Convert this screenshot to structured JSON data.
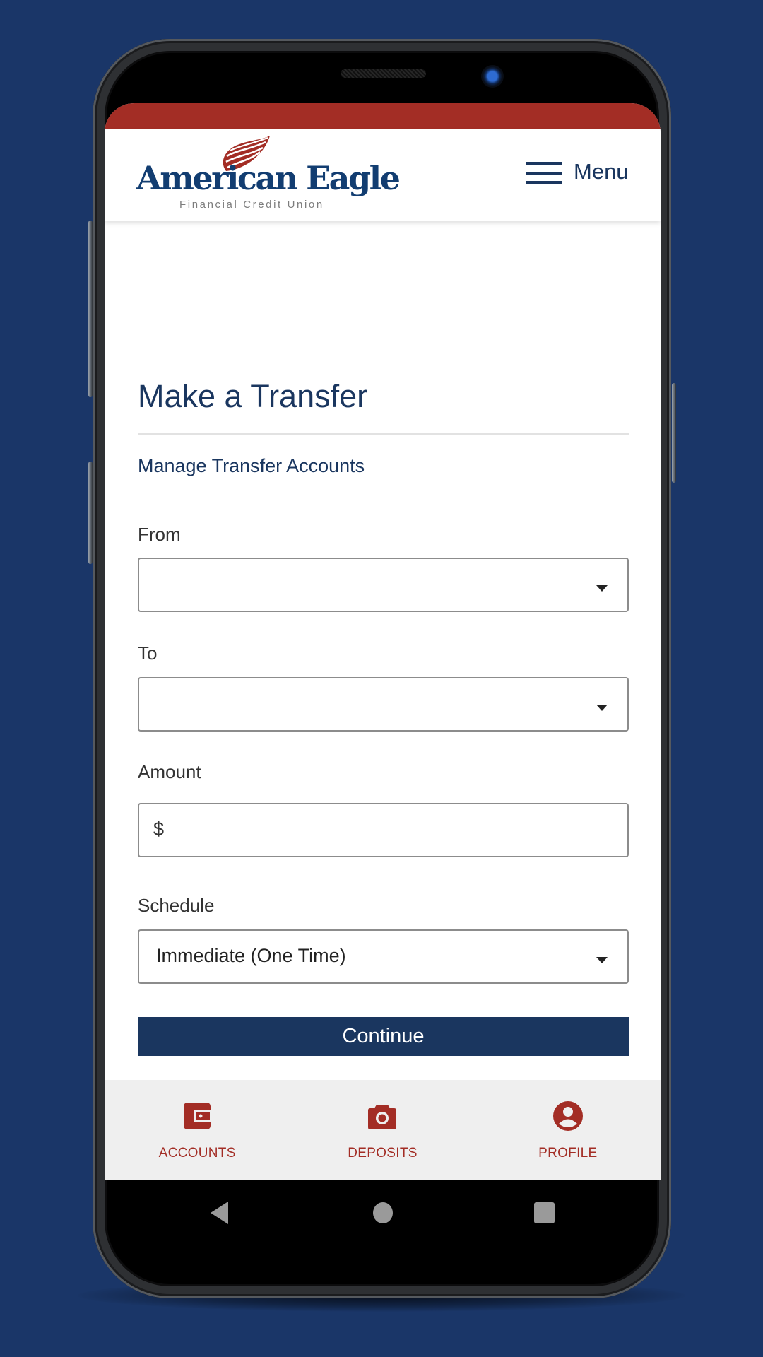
{
  "colors": {
    "background": "#1a3668",
    "brand_red": "#a32d25",
    "brand_navy": "#1a365f"
  },
  "header": {
    "logo": {
      "name": "American Eagle",
      "subtitle": "Financial Credit Union",
      "icon": "feather-icon"
    },
    "menu": {
      "label": "Menu",
      "icon": "hamburger-icon"
    }
  },
  "page": {
    "title": "Make a Transfer",
    "manage_link": "Manage Transfer Accounts"
  },
  "form": {
    "from": {
      "label": "From",
      "value": "",
      "icon": "caret-down-icon"
    },
    "to": {
      "label": "To",
      "value": "",
      "icon": "caret-down-icon"
    },
    "amount": {
      "label": "Amount",
      "prefix": "$",
      "value": ""
    },
    "schedule": {
      "label": "Schedule",
      "value": "Immediate (One Time)",
      "icon": "caret-down-icon"
    },
    "continue_label": "Continue"
  },
  "bottom_nav": {
    "items": [
      {
        "label": "ACCOUNTS",
        "icon": "wallet-icon"
      },
      {
        "label": "DEPOSITS",
        "icon": "camera-icon"
      },
      {
        "label": "PROFILE",
        "icon": "account-circle-icon"
      }
    ]
  },
  "system_nav": {
    "back": "back-icon",
    "home": "home-icon",
    "recents": "recents-icon"
  }
}
